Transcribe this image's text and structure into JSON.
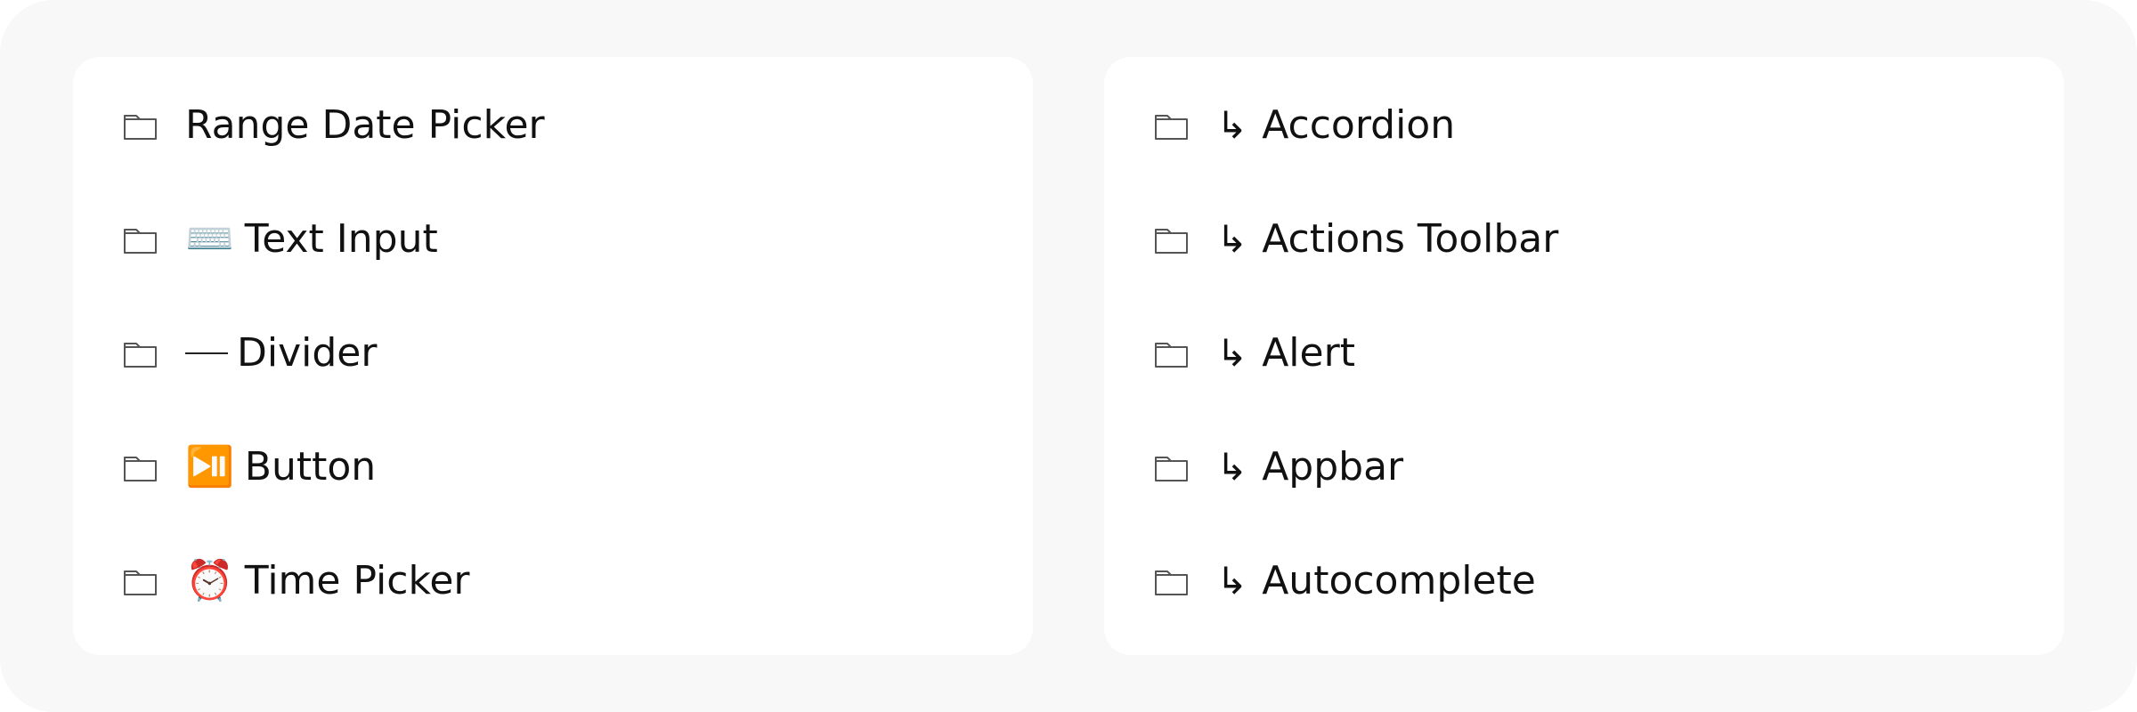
{
  "left_panel": {
    "items": [
      {
        "icon": "folder-icon",
        "emoji": "",
        "label": "Range Date Picker"
      },
      {
        "icon": "folder-icon",
        "emoji": "⌨️",
        "label": "Text Input"
      },
      {
        "icon": "folder-icon",
        "emoji": "dash",
        "label": "Divider"
      },
      {
        "icon": "folder-icon",
        "emoji": "⏯️",
        "label": "Button"
      },
      {
        "icon": "folder-icon",
        "emoji": "⏰",
        "label": "Time Picker"
      }
    ]
  },
  "right_panel": {
    "arrow": "↳",
    "items": [
      {
        "icon": "folder-icon",
        "label": "Accordion"
      },
      {
        "icon": "folder-icon",
        "label": "Actions Toolbar"
      },
      {
        "icon": "folder-icon",
        "label": "Alert"
      },
      {
        "icon": "folder-icon",
        "label": "Appbar"
      },
      {
        "icon": "folder-icon",
        "label": "Autocomplete"
      }
    ]
  }
}
